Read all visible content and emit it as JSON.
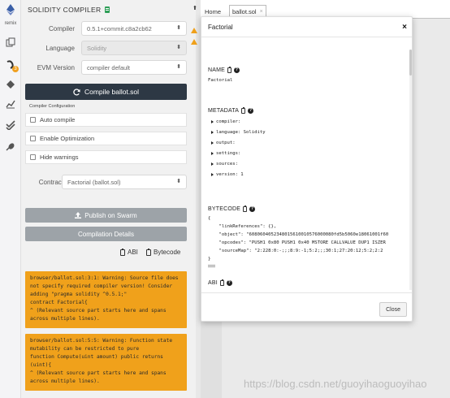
{
  "rail": {
    "logo_label": "remix",
    "compiler_badge": "3"
  },
  "panel": {
    "title": "SOLIDITY COMPILER",
    "compiler_label": "Compiler",
    "compiler_value": "0.5.1+commit.c8a2cb62",
    "language_label": "Language",
    "language_value": "Solidity",
    "evm_label": "EVM Version",
    "evm_value": "compiler default",
    "compile_button": "Compile ballot.sol",
    "config_label": "Compiler Configuration",
    "auto_compile": "Auto compile",
    "enable_optimization": "Enable Optimization",
    "hide_warnings": "Hide warnings",
    "contract_label": "Contract",
    "contract_value": "Factorial (ballot.sol)",
    "publish_swarm": "Publish on Swarm",
    "compilation_details": "Compilation Details",
    "abi_link": "ABI",
    "bytecode_link": "Bytecode",
    "warnings": [
      {
        "lines": [
          "browser/ballot.sol:3:1: Warning: Source file does",
          "not specify required compiler version! Consider",
          "adding \"pragma solidity ^0.5.1;\"",
          "contract Factorial{",
          "^ (Relevant source part starts here and spans",
          "across multiple lines)."
        ]
      },
      {
        "lines": [
          "browser/ballot.sol:5:5: Warning: Function state",
          "mutability can be restricted to pure",
          "function Compute(uint amount) public returns",
          "(uint){",
          "^ (Relevant source part starts here and spans",
          "across multiple lines)."
        ]
      }
    ]
  },
  "tabs": {
    "home": "Home",
    "ballot": "ballot.sol",
    "ballot_close": "×"
  },
  "modal": {
    "title": "Factorial",
    "close_x": "×",
    "name_title": "NAME",
    "name_value": "Factorial",
    "metadata_title": "METADATA",
    "metadata_items": [
      "compiler:",
      "language: Solidity",
      "output:",
      "settings:",
      "sources:",
      "version: 1"
    ],
    "bytecode_title": "BYTECODE",
    "bytecode_lines": [
      "{",
      "    \"linkReferences\": {},",
      "    \"object\": \"6080604052348015610010576000080fd5b5060e18061001f60",
      "    \"opcodes\": \"PUSH1 0x80 PUSH1 0x40 MSTORE CALLVALUE DUP1 ISZER",
      "    \"sourceMap\": \"2:228:0:-;;;8:9:-1;5:2;;;30:1;27:20:12;5:2;2:2",
      "}"
    ],
    "abi_title": "ABI",
    "abi_item": "0:",
    "close_button": "Close"
  },
  "watermark": "https://blog.csdn.net/guoyihaoguoyihao",
  "colors": {
    "compile_button_bg": "#2d3844",
    "warning_bg": "#f0a11b",
    "gray_button_bg": "#9da3a8",
    "remix_logo": "#3b5fa8"
  }
}
